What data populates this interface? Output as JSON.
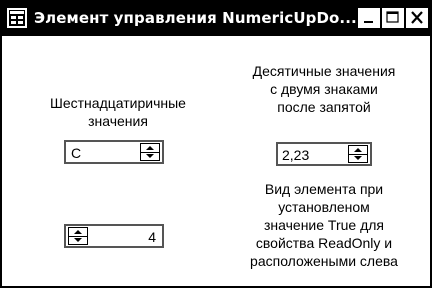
{
  "window": {
    "title": "Элемент управления NumericUpDo...",
    "buttons": {
      "minimize": "minimize-icon",
      "maximize": "maximize-icon",
      "close": "close-icon"
    }
  },
  "labels": {
    "hex": [
      "Шестнадцатиричные",
      "значения"
    ],
    "decimal": [
      "Десятичные значения",
      "с двумя знаками",
      "после запятой"
    ],
    "readonly": [
      "Вид элемента при",
      "установленом",
      "значение True для",
      "свойства ReadOnly и",
      "расположеными слева"
    ]
  },
  "controls": {
    "hex_value": "C",
    "decimal_value": "2,23",
    "readonly_value": "4"
  },
  "colors": {
    "titlebar": "#000000",
    "background": "#ffffff",
    "text": "#000000"
  }
}
